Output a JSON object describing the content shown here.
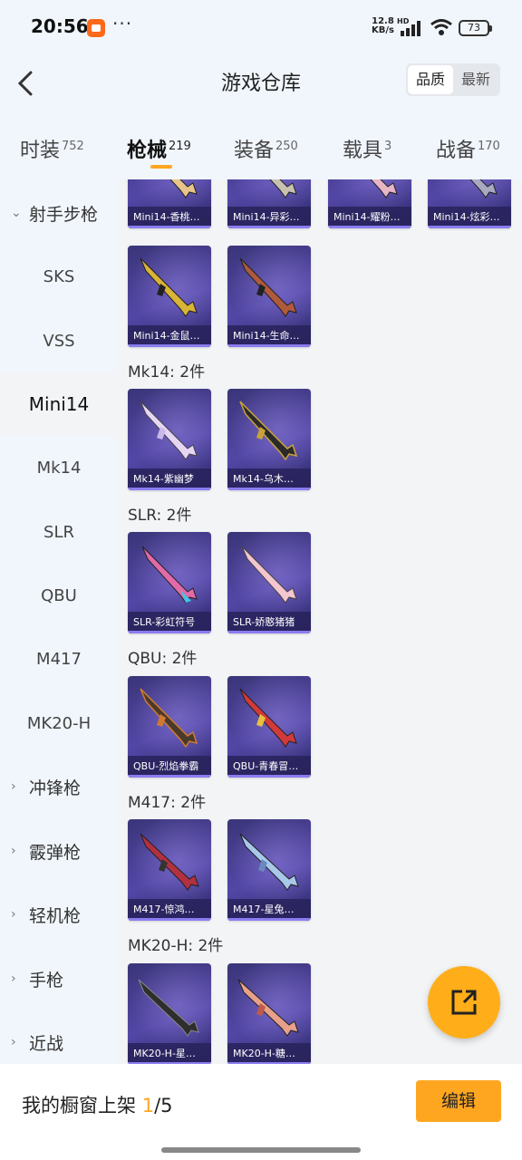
{
  "status_bar": {
    "time": "20:56",
    "dots": "···",
    "net_speed_top": "12.8",
    "net_speed_bottom": "KB/s",
    "hd": "HD",
    "battery": "73"
  },
  "header": {
    "title": "游戏仓库",
    "sort": {
      "options": [
        "品质",
        "最新"
      ],
      "selected": "品质"
    }
  },
  "tabs": [
    {
      "label": "时装",
      "count": "752"
    },
    {
      "label": "枪械",
      "count": "219"
    },
    {
      "label": "装备",
      "count": "250"
    },
    {
      "label": "载具",
      "count": "3"
    },
    {
      "label": "战备",
      "count": "170"
    }
  ],
  "sidebar": [
    {
      "label": "射手步枪",
      "type": "group",
      "expanded": true
    },
    {
      "label": "SKS"
    },
    {
      "label": "VSS"
    },
    {
      "label": "Mini14",
      "active": true
    },
    {
      "label": "Mk14"
    },
    {
      "label": "SLR"
    },
    {
      "label": "QBU"
    },
    {
      "label": "M417"
    },
    {
      "label": "MK20-H"
    },
    {
      "label": "冲锋枪",
      "type": "group"
    },
    {
      "label": "霰弹枪",
      "type": "group"
    },
    {
      "label": "轻机枪",
      "type": "group"
    },
    {
      "label": "手枪",
      "type": "group"
    },
    {
      "label": "近战",
      "type": "group"
    }
  ],
  "main": {
    "top_row": [
      "Mini14-香桃…",
      "Mini14-异彩…",
      "Mini14-耀粉…",
      "Mini14-炫彩…"
    ],
    "row_mini14b": [
      "Mini14-金鼠…",
      "Mini14-生命…"
    ],
    "sections": [
      {
        "title": "Mk14: 2件",
        "items": [
          "Mk14-紫幽梦",
          "Mk14-乌木…"
        ]
      },
      {
        "title": "SLR: 2件",
        "items": [
          "SLR-彩虹符号",
          "SLR-娇憨猪猪"
        ]
      },
      {
        "title": "QBU: 2件",
        "items": [
          "QBU-烈焰拳霸",
          "QBU-青春冒…"
        ]
      },
      {
        "title": "M417: 2件",
        "items": [
          "M417-惊鸿…",
          "M417-星兔…"
        ]
      },
      {
        "title": "MK20-H: 2件",
        "items": [
          "MK20-H-星…",
          "MK20-H-糖…"
        ]
      }
    ]
  },
  "bottom": {
    "shelf_prefix": "我的橱窗上架 ",
    "shelf_current": "1",
    "shelf_suffix": "/5",
    "edit_label": "编辑"
  },
  "colors": {
    "accent": "#ffa621",
    "card_bg": "#4a3f99",
    "page_bg": "#f1f6fd"
  }
}
